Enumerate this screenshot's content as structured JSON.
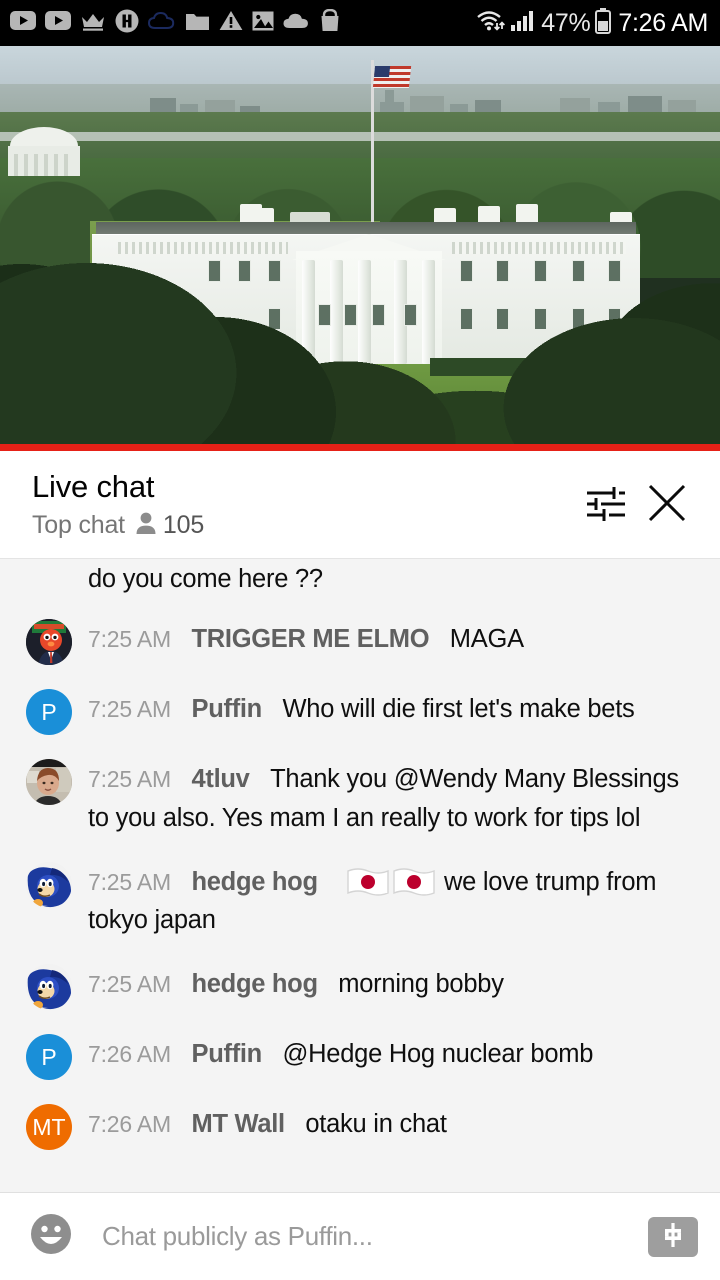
{
  "status_bar": {
    "icons": [
      "youtube-icon",
      "youtube-icon",
      "crown-icon",
      "messenger-icon",
      "cloud-outline-icon",
      "folder-icon",
      "warning-triangle-icon",
      "photo-icon",
      "cloud-filled-icon",
      "shopping-bag-icon"
    ],
    "wifi_icon": "wifi-icon",
    "signal_icon": "cellular-signal-icon",
    "battery_percent": "47%",
    "battery_icon": "battery-icon",
    "clock": "7:26 AM"
  },
  "video": {
    "name": "white-house-live-stream",
    "progress_color": "#e62117",
    "progress_percent": 100
  },
  "chat_header": {
    "title": "Live chat",
    "mode": "Top chat",
    "viewer_icon": "person-icon",
    "viewer_count": "105",
    "settings_icon": "chat-settings-icon",
    "close_icon": "close-icon"
  },
  "messages": [
    {
      "partial": true,
      "avatar": {
        "type": "none",
        "initials": "",
        "color": ""
      },
      "timestamp": "",
      "author": "",
      "text": "do you come here ??"
    },
    {
      "partial": false,
      "avatar": {
        "type": "photo-elmo",
        "initials": "",
        "color": "#2b2b2b"
      },
      "timestamp": "7:25 AM",
      "author": "TRIGGER ME ELMO",
      "text": "MAGA"
    },
    {
      "partial": false,
      "avatar": {
        "type": "initial",
        "initials": "P",
        "color": "#1a8fd8"
      },
      "timestamp": "7:25 AM",
      "author": "Puffin",
      "text": "Who will die first let's make bets"
    },
    {
      "partial": false,
      "avatar": {
        "type": "photo-woman",
        "initials": "",
        "color": "#b9b2a6"
      },
      "timestamp": "7:25 AM",
      "author": "4tluv",
      "text": "Thank you @Wendy Many Blessings to you also. Yes mam I an really to work for tips lol"
    },
    {
      "partial": false,
      "avatar": {
        "type": "photo-sonic",
        "initials": "",
        "color": "#eaeaea"
      },
      "timestamp": "7:25 AM",
      "author": "hedge hog",
      "emojis": [
        "japan-flag-emoji",
        "japan-flag-emoji"
      ],
      "text": "we love trump from tokyo japan"
    },
    {
      "partial": false,
      "avatar": {
        "type": "photo-sonic",
        "initials": "",
        "color": "#eaeaea"
      },
      "timestamp": "7:25 AM",
      "author": "hedge hog",
      "text": "morning bobby"
    },
    {
      "partial": false,
      "avatar": {
        "type": "initial",
        "initials": "P",
        "color": "#1a8fd8"
      },
      "timestamp": "7:26 AM",
      "author": "Puffin",
      "text": "@Hedge Hog nuclear bomb"
    },
    {
      "partial": false,
      "avatar": {
        "type": "initial",
        "initials": "MT",
        "color": "#ef6c00"
      },
      "timestamp": "7:26 AM",
      "author": "MT Wall",
      "text": "otaku in chat"
    }
  ],
  "composer": {
    "emoji_icon": "emoji-smiley-icon",
    "placeholder": "Chat publicly as Puffin...",
    "value": "",
    "superchat_icon": "super-chat-dollar-icon"
  }
}
